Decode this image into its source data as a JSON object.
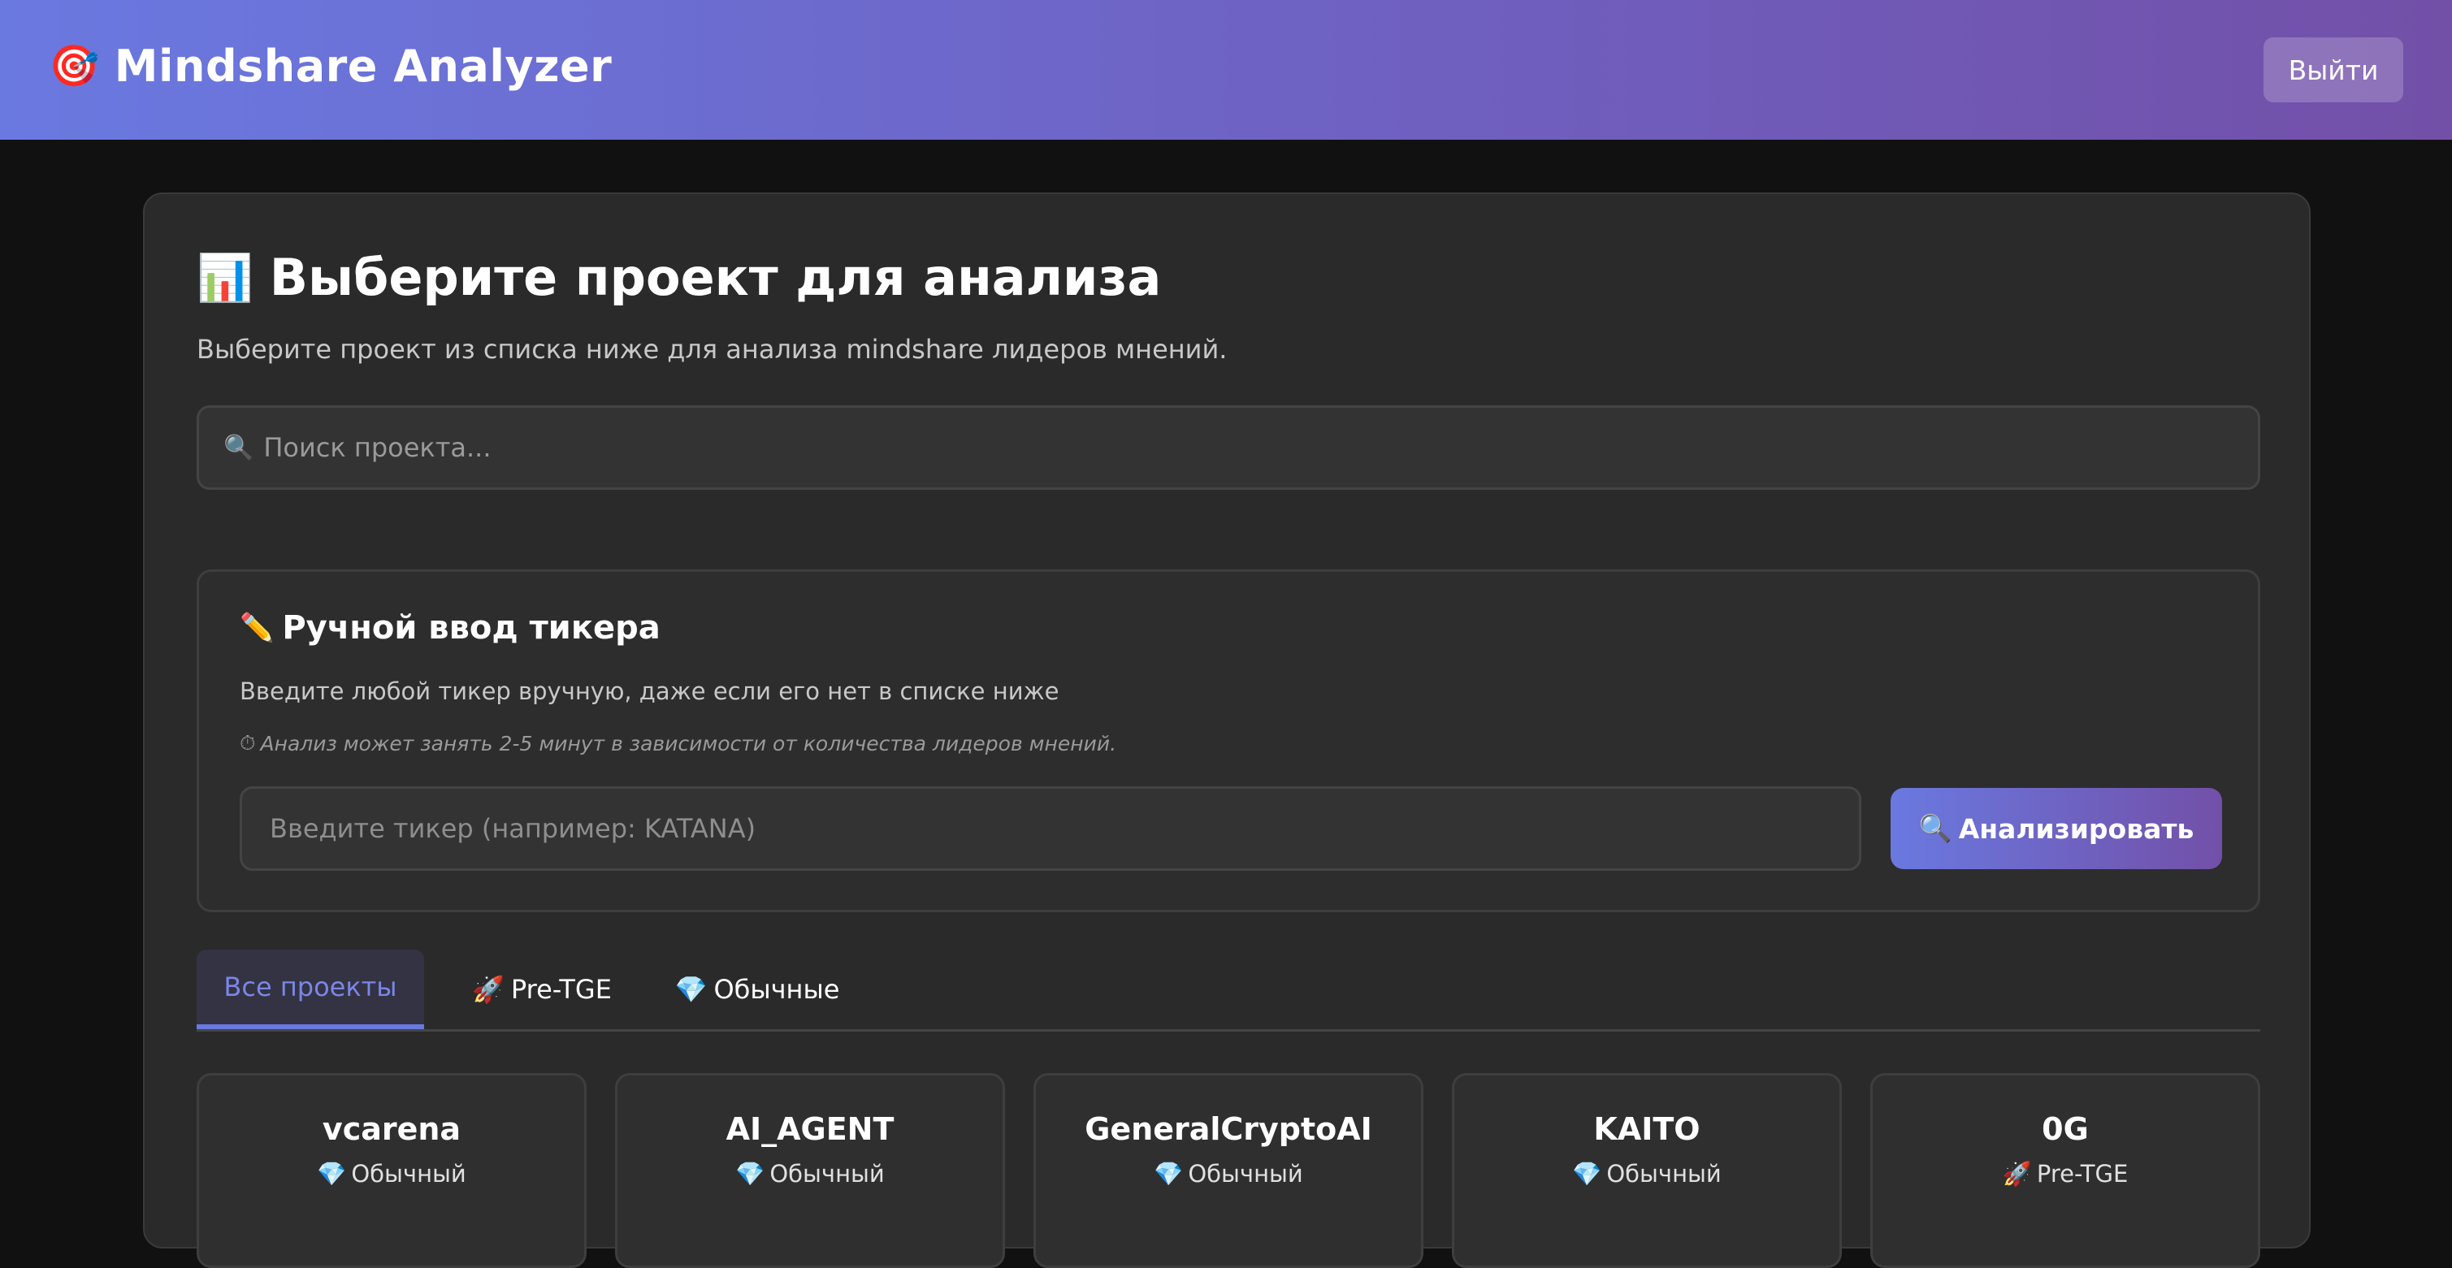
{
  "header": {
    "logo_icon": "🎯",
    "title": "Mindshare Analyzer",
    "logout_label": "Выйти"
  },
  "main": {
    "title_icon": "📊",
    "title": "Выберите проект для анализа",
    "subtitle": "Выберите проект из списка ниже для анализа mindshare лидеров мнений.",
    "search": {
      "icon": "🔍",
      "placeholder": "Поиск проекта..."
    }
  },
  "manual": {
    "title_icon": "✏️",
    "title": "Ручной ввод тикера",
    "description": "Введите любой тикер вручную, даже если его нет в списке ниже",
    "note_icon": "⏱",
    "note": "Анализ может занять 2-5 минут в зависимости от количества лидеров мнений.",
    "ticker_placeholder": "Введите тикер (например: KATANA)",
    "analyze_icon": "🔍",
    "analyze_label": "Анализировать"
  },
  "tabs": [
    {
      "icon": "",
      "label": "Все проекты",
      "active": true
    },
    {
      "icon": "🚀",
      "label": "Pre-TGE",
      "active": false
    },
    {
      "icon": "💎",
      "label": "Обычные",
      "active": false
    }
  ],
  "projects": [
    {
      "name": "vcarena",
      "type_icon": "💎",
      "type": "Обычный"
    },
    {
      "name": "AI_AGENT",
      "type_icon": "💎",
      "type": "Обычный"
    },
    {
      "name": "GeneralCryptoAI",
      "type_icon": "💎",
      "type": "Обычный"
    },
    {
      "name": "KAITO",
      "type_icon": "💎",
      "type": "Обычный"
    },
    {
      "name": "0G",
      "type_icon": "🚀",
      "type": "Pre-TGE"
    }
  ],
  "colors": {
    "header_gradient_start": "#6a79e0",
    "header_gradient_end": "#7250a8",
    "accent": "#6a79e0",
    "background": "#111111",
    "card": "#2a2a2a"
  }
}
